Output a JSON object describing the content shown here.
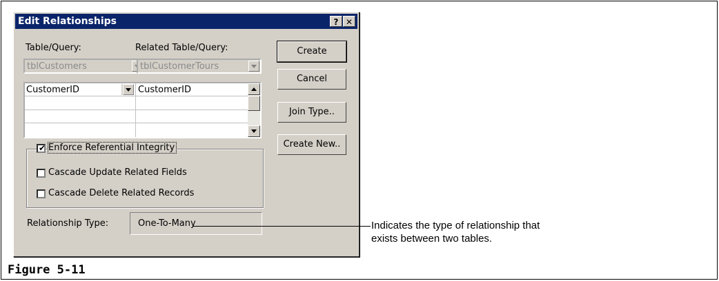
{
  "dialog": {
    "title": "Edit Relationships",
    "help_button": "?",
    "close_button": "✕",
    "table_query_label": "Table/Query:",
    "related_table_query_label": "Related Table/Query:",
    "table_value": "tblCustomers",
    "related_table_value": "tblCustomerTours",
    "grid_rows": [
      {
        "left": "CustomerID",
        "right": "CustomerID"
      },
      {
        "left": "",
        "right": ""
      },
      {
        "left": "",
        "right": ""
      },
      {
        "left": "",
        "right": ""
      }
    ],
    "buttons": {
      "create": "Create",
      "cancel": "Cancel",
      "join_type": "Join Type..",
      "create_new": "Create New.."
    },
    "enforce_integrity": {
      "label": "Enforce Referential Integrity",
      "checked": true
    },
    "cascade_update": {
      "label": "Cascade Update Related Fields",
      "checked": false
    },
    "cascade_delete": {
      "label": "Cascade Delete Related Records",
      "checked": false
    },
    "relationship_type_label": "Relationship Type:",
    "relationship_type_value": "One-To-Many"
  },
  "callout": {
    "line1": "Indicates the type of relationship that",
    "line2": "exists between two tables."
  },
  "figure_caption": "Figure 5-11"
}
